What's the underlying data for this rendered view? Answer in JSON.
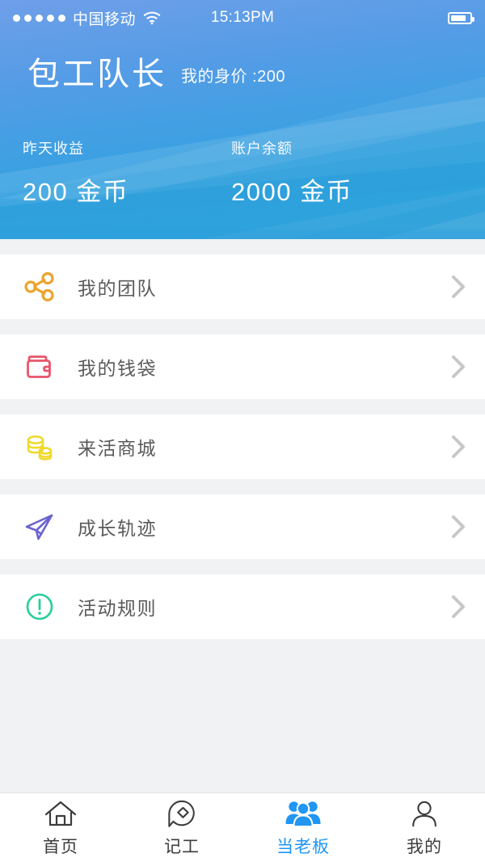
{
  "statusbar": {
    "signal_dots": 5,
    "carrier": "中国移动",
    "wifi_icon": "wifi-icon",
    "time": "15:13PM",
    "battery_icon": "battery-icon"
  },
  "header": {
    "title": "包工队长",
    "subtitle": "我的身价 :200",
    "gradient_from": "#6f9ee8",
    "gradient_to": "#2fa3de",
    "stats": [
      {
        "label": "昨天收益",
        "value": "200 金币"
      },
      {
        "label": "账户余额",
        "value": "2000 金币"
      }
    ]
  },
  "menu": {
    "chevron_icon": "chevron-right-icon",
    "items": [
      {
        "label": "我的团队",
        "icon": "share-network-icon",
        "color": "#eba42e"
      },
      {
        "label": "我的钱袋",
        "icon": "wallet-icon",
        "color": "#e8556b"
      },
      {
        "label": "来活商城",
        "icon": "coins-icon",
        "color": "#f0d92e"
      },
      {
        "label": "成长轨迹",
        "icon": "paper-plane-icon",
        "color": "#6b63cf"
      },
      {
        "label": "活动规则",
        "icon": "exclamation-circle-icon",
        "color": "#28ce9a"
      }
    ]
  },
  "tabbar": {
    "active_color": "#2196f3",
    "inactive_color": "#3c3c3c",
    "tabs": [
      {
        "label": "首页",
        "icon": "home-icon",
        "active": false
      },
      {
        "label": "记工",
        "icon": "location-diamond-icon",
        "active": false
      },
      {
        "label": "当老板",
        "icon": "group-users-icon",
        "active": true
      },
      {
        "label": "我的",
        "icon": "person-icon",
        "active": false
      }
    ]
  }
}
